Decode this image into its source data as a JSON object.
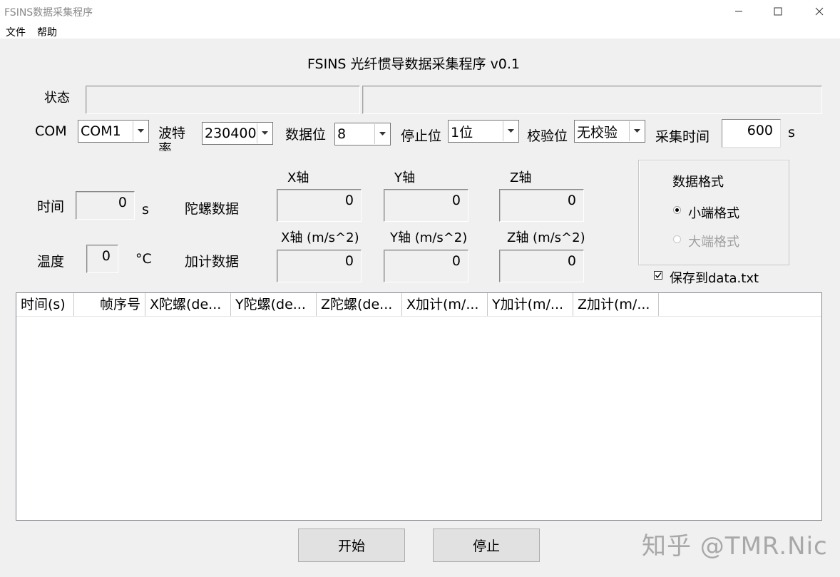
{
  "window": {
    "title": "FSINS数据采集程序",
    "controls": [
      "minimize-icon",
      "maximize-icon",
      "close-icon"
    ]
  },
  "menu": {
    "items": [
      "文件",
      "帮助"
    ]
  },
  "main_title": "FSINS 光纤惯导数据采集程序 v0.1",
  "status": {
    "label": "状态",
    "field1": "",
    "field2": ""
  },
  "serial": {
    "com_label": "COM",
    "com_value": "COM1",
    "baud_label_line1": "波特",
    "baud_label_line2": "率",
    "baud_value": "230400",
    "databits_label": "数据位",
    "databits_value": "8",
    "stopbits_label": "停止位",
    "stopbits_value": "1位",
    "parity_label": "校验位",
    "parity_value": "无校验",
    "duration_label": "采集时间",
    "duration_value": "600",
    "duration_unit": "s"
  },
  "readouts": {
    "time_label": "时间",
    "time_value": "0",
    "time_unit": "s",
    "temp_label": "温度",
    "temp_value": "0",
    "temp_unit": "°C",
    "gyro_label": "陀螺数据",
    "accel_label": "加计数据",
    "gyro_axes": [
      "X轴",
      "Y轴",
      "Z轴"
    ],
    "accel_axes": [
      "X轴 (m/s^2)",
      "Y轴 (m/s^2)",
      "Z轴 (m/s^2)"
    ],
    "gyro_values": [
      "0",
      "0",
      "0"
    ],
    "accel_values": [
      "0",
      "0",
      "0"
    ]
  },
  "format": {
    "title": "数据格式",
    "option_little": "小端格式",
    "option_big": "大端格式",
    "selected": "小端格式"
  },
  "save": {
    "label": "保存到data.txt",
    "checked": true
  },
  "table": {
    "columns": [
      "时间(s)",
      "帧序号",
      "X陀螺(de...",
      "Y陀螺(de...",
      "Z陀螺(de...",
      "X加计(m/...",
      "Y加计(m/...",
      "Z加计(m/..."
    ],
    "rows": []
  },
  "buttons": {
    "start": "开始",
    "stop": "停止"
  },
  "watermark": "知乎 @TMR.Nic"
}
